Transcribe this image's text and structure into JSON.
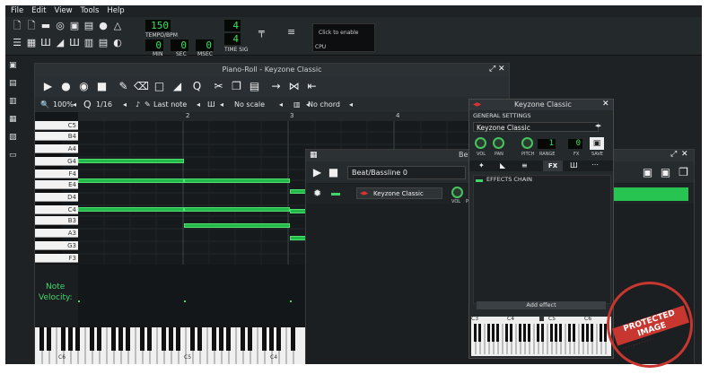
{
  "menu": [
    "File",
    "Edit",
    "View",
    "Tools",
    "Help"
  ],
  "toolbar": {
    "tempo_value": "150",
    "tempo_label": "TEMPO/BPM",
    "min_value": "0",
    "sec_value": "0",
    "msec_value": "0",
    "min_label": "MIN",
    "sec_label": "SEC",
    "msec_label": "MSEC",
    "timesig_top": "4",
    "timesig_bottom": "4",
    "timesig_label": "TIME SIG",
    "cpu_hint": "Click to enable",
    "cpu_label": "CPU"
  },
  "piano_roll": {
    "title": "Piano-Roll - Keyzone Classic",
    "zoom": "100%",
    "quantize": "1/16",
    "note_length": "Last note",
    "scale": "No scale",
    "chord": "No chord",
    "bars": [
      "2",
      "3",
      "4"
    ],
    "keys": [
      "C5",
      "B4",
      "A4",
      "G4",
      "F4",
      "E4",
      "D4",
      "C4",
      "B3",
      "A3",
      "G3",
      "F3"
    ],
    "velocity_label_1": "Note",
    "velocity_label_2": "Velocity:",
    "bottom_octaves": [
      "C6",
      "C5",
      "C4"
    ]
  },
  "beat_bassline": {
    "title_short": "Be",
    "pattern": "Beat/Bassline 0",
    "track_name": "Keyzone Classic",
    "vol_label": "VOL",
    "pan_label": "PA"
  },
  "instrument": {
    "title": "Keyzone Classic",
    "section": "GENERAL SETTINGS",
    "preset": "Keyzone Classic",
    "knobs": [
      "VOL",
      "PAN",
      "PITCH",
      "RANGE",
      "FX",
      "SAVE"
    ],
    "range_value": "1",
    "fx_value": "0",
    "tabs": [
      "FX"
    ],
    "effects_chain": "EFFECTS CHAIN",
    "add_effect": "Add effect",
    "keyboard_labels": [
      "C3",
      "C4",
      "C5",
      "C6"
    ]
  },
  "watermark": {
    "text": "PROTECTED IMAGE"
  },
  "colors": {
    "note_green": "#23b84a",
    "lcd_green": "#35e35a",
    "panel": "#24292c",
    "watermark_red": "#c8372f"
  }
}
